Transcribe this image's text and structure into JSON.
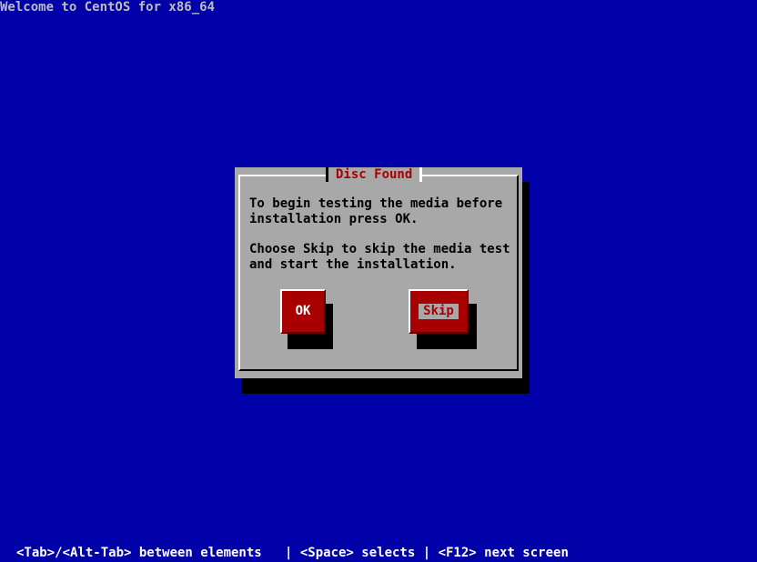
{
  "screen": {
    "title": "Welcome to CentOS for x86_64",
    "background_color": "#0000a8"
  },
  "dialog": {
    "title": "Disc Found",
    "lines": [
      "To begin testing the media before",
      "installation press OK.",
      "Choose Skip to skip the media test",
      "and start the installation."
    ],
    "buttons": {
      "ok_label": "OK",
      "skip_label": "Skip"
    },
    "focused_button": "Skip"
  },
  "help": {
    "text": "<Tab>/<Alt-Tab> between elements   | <Space> selects | <F12> next screen"
  },
  "colors": {
    "dialog_bg": "#a8a8a8",
    "title_fg": "#a80000",
    "button_bg": "#a80000"
  }
}
